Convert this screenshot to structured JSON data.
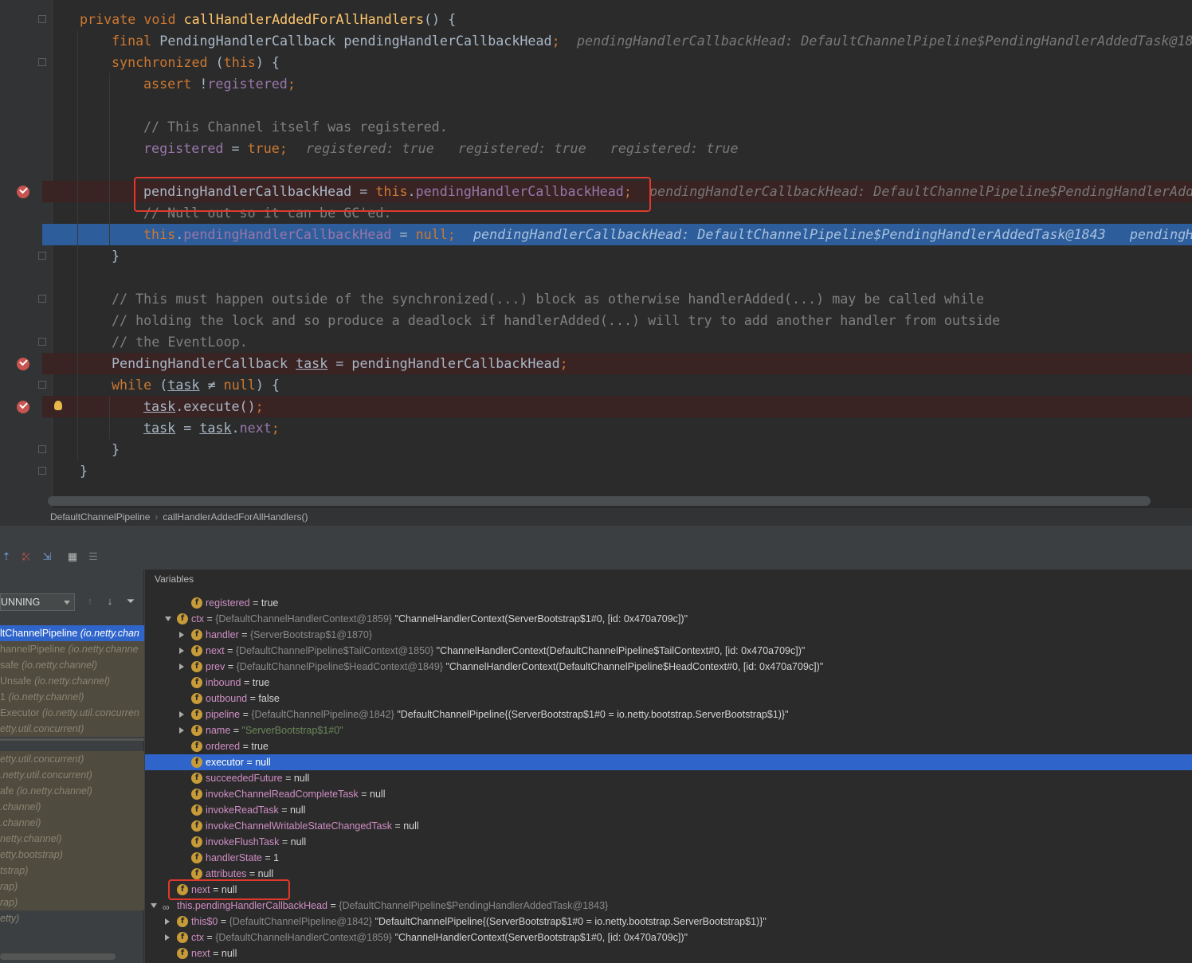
{
  "editor": {
    "lines": [
      {
        "code": [
          [
            "kw",
            "private void "
          ],
          [
            "fn",
            "callHandlerAddedForAllHandlers"
          ],
          [
            "",
            "() {"
          ]
        ],
        "indent": 0
      },
      {
        "code": [
          [
            "kw",
            "final "
          ],
          [
            "",
            "PendingHandlerCallback pendingHandlerCallbackHead"
          ],
          [
            "kw",
            ";"
          ]
        ],
        "indent": 1,
        "hint": "pendingHandlerCallbackHead: DefaultChannelPipeline$PendingHandlerAddedTask@18"
      },
      {
        "code": [
          [
            "kw",
            "synchronized "
          ],
          [
            "",
            "("
          ],
          [
            "kw",
            "this"
          ],
          [
            "",
            ") {"
          ]
        ],
        "indent": 1
      },
      {
        "code": [
          [
            "kw",
            "assert "
          ],
          [
            "",
            "!"
          ],
          [
            "fld",
            "registered"
          ],
          [
            "kw",
            ";"
          ]
        ],
        "indent": 2
      },
      {
        "code": [],
        "indent": 2
      },
      {
        "code": [
          [
            "cm",
            "// This Channel itself was registered."
          ]
        ],
        "indent": 2
      },
      {
        "code": [
          [
            "fld",
            "registered"
          ],
          [
            "",
            " = "
          ],
          [
            "kw",
            "true;"
          ]
        ],
        "indent": 2,
        "hint": "registered: true   registered: true   registered: true"
      },
      {
        "code": [],
        "indent": 2
      },
      {
        "code": [
          [
            "",
            "pendingHandlerCallbackHead = "
          ],
          [
            "kw",
            "this"
          ],
          [
            "",
            "."
          ],
          [
            "fld",
            "pendingHandlerCallbackHead"
          ],
          [
            "kw",
            ";"
          ]
        ],
        "indent": 2,
        "hint": "pendingHandlerCallbackHead: DefaultChannelPipeline$PendingHandlerAdde",
        "bp": true
      },
      {
        "code": [
          [
            "cm",
            "// Null out so it can be GC'ed."
          ]
        ],
        "indent": 2
      },
      {
        "code": [
          [
            "kw",
            "this"
          ],
          [
            "",
            "."
          ],
          [
            "fld",
            "pendingHandlerCallbackHead"
          ],
          [
            "",
            " = "
          ],
          [
            "kw",
            "null;"
          ]
        ],
        "indent": 2,
        "hint": "pendingHandlerCallbackHead: DefaultChannelPipeline$PendingHandlerAddedTask@1843   pendingH",
        "sel": true
      },
      {
        "code": [
          [
            "",
            "}"
          ]
        ],
        "indent": 1
      },
      {
        "code": [],
        "indent": 1
      },
      {
        "code": [
          [
            "cm",
            "// This must happen outside of the synchronized(...) block as otherwise handlerAdded(...) may be called while"
          ]
        ],
        "indent": 1
      },
      {
        "code": [
          [
            "cm",
            "// holding the lock and so produce a deadlock if handlerAdded(...) will try to add another handler from outside"
          ]
        ],
        "indent": 1
      },
      {
        "code": [
          [
            "cm",
            "// the EventLoop."
          ]
        ],
        "indent": 1
      },
      {
        "code": [
          [
            "",
            "PendingHandlerCallback "
          ],
          [
            "ul",
            "task"
          ],
          [
            "",
            " = pendingHandlerCallbackHead"
          ],
          [
            "kw",
            ";"
          ]
        ],
        "indent": 1,
        "bp": true
      },
      {
        "code": [
          [
            "kw",
            "while "
          ],
          [
            "",
            "("
          ],
          [
            "ul",
            "task"
          ],
          [
            "",
            " ≠ "
          ],
          [
            "kw",
            "null"
          ],
          [
            "",
            ") {"
          ]
        ],
        "indent": 1
      },
      {
        "code": [
          [
            "ul",
            "task"
          ],
          [
            "",
            ".execute()"
          ],
          [
            "kw",
            ";"
          ]
        ],
        "indent": 2,
        "bp": true,
        "bulb": true
      },
      {
        "code": [
          [
            "ul",
            "task"
          ],
          [
            "",
            " = "
          ],
          [
            "ul",
            "task"
          ],
          [
            "",
            "."
          ],
          [
            "fld",
            "next"
          ],
          [
            "kw",
            ";"
          ]
        ],
        "indent": 2
      },
      {
        "code": [
          [
            "",
            "}"
          ]
        ],
        "indent": 1
      },
      {
        "code": [
          [
            "",
            "}"
          ]
        ],
        "indent": 0
      }
    ]
  },
  "breadcrumb": [
    "DefaultChannelPipeline",
    "callHandlerAddedForAllHandlers()"
  ],
  "debugger": {
    "toolbar_icons": [
      "step-out-icon",
      "drop-frame-icon",
      "run-to-cursor-icon",
      "evaluate-icon",
      "trace-icon"
    ],
    "thread_select": "UNNING",
    "frames": [
      {
        "method": "ltChannelPipeline ",
        "pkg": "(io.netty.chan",
        "sel": true
      },
      {
        "method": "hannelPipeline ",
        "pkg": "(io.netty.channe",
        "lib": true
      },
      {
        "method": "safe ",
        "pkg": "(io.netty.channel)",
        "lib": true
      },
      {
        "method": "Unsafe ",
        "pkg": "(io.netty.channel)",
        "lib": true
      },
      {
        "method": "1 ",
        "pkg": "(io.netty.channel)",
        "lib": true
      },
      {
        "method": "Executor ",
        "pkg": "(io.netty.util.concurren",
        "lib": true
      },
      {
        "method": "",
        "pkg": "etty.util.concurrent)",
        "lib": true
      },
      {
        "method": "",
        "pkg": "",
        "lib": false
      },
      {
        "method": "",
        "pkg": "etty.util.concurrent)",
        "lib": true
      },
      {
        "method": "",
        "pkg": ".netty.util.concurrent)",
        "lib": true
      },
      {
        "method": "afe ",
        "pkg": "(io.netty.channel)",
        "lib": true
      },
      {
        "method": "",
        "pkg": ".channel)",
        "lib": true
      },
      {
        "method": "",
        "pkg": ".channel)",
        "lib": true
      },
      {
        "method": "",
        "pkg": "netty.channel)",
        "lib": true
      },
      {
        "method": "",
        "pkg": "etty.bootstrap)",
        "lib": true
      },
      {
        "method": "",
        "pkg": "tstrap)",
        "lib": true
      },
      {
        "method": "",
        "pkg": "rap)",
        "lib": true
      },
      {
        "method": "",
        "pkg": "rap)",
        "lib": true
      },
      {
        "method": "",
        "pkg": "etty)",
        "lib": false
      }
    ],
    "variables_title": "Variables",
    "variables": [
      {
        "lvl": 3,
        "tw": "",
        "icon": "f",
        "name": "registered",
        "type": "",
        "value": "true"
      },
      {
        "lvl": 2,
        "tw": "d",
        "icon": "f",
        "name": "ctx",
        "type": "{DefaultChannelHandlerContext@1859}",
        "value": "\"ChannelHandlerContext(ServerBootstrap$1#0, [id: 0x470a709c])\""
      },
      {
        "lvl": 3,
        "tw": "r",
        "icon": "f",
        "name": "handler",
        "type": "{ServerBootstrap$1@1870}",
        "value": ""
      },
      {
        "lvl": 3,
        "tw": "r",
        "icon": "f",
        "name": "next",
        "type": "{DefaultChannelPipeline$TailContext@1850}",
        "value": "\"ChannelHandlerContext(DefaultChannelPipeline$TailContext#0, [id: 0x470a709c])\""
      },
      {
        "lvl": 3,
        "tw": "r",
        "icon": "f",
        "name": "prev",
        "type": "{DefaultChannelPipeline$HeadContext@1849}",
        "value": "\"ChannelHandlerContext(DefaultChannelPipeline$HeadContext#0, [id: 0x470a709c])\""
      },
      {
        "lvl": 3,
        "tw": "",
        "icon": "f",
        "name": "inbound",
        "type": "",
        "value": "true"
      },
      {
        "lvl": 3,
        "tw": "",
        "icon": "f",
        "name": "outbound",
        "type": "",
        "value": "false"
      },
      {
        "lvl": 3,
        "tw": "r",
        "icon": "f",
        "name": "pipeline",
        "type": "{DefaultChannelPipeline@1842}",
        "value": "\"DefaultChannelPipeline{(ServerBootstrap$1#0 = io.netty.bootstrap.ServerBootstrap$1)}\""
      },
      {
        "lvl": 3,
        "tw": "r",
        "icon": "f",
        "name": "name",
        "type": "",
        "value": "\"ServerBootstrap$1#0\"",
        "str": true
      },
      {
        "lvl": 3,
        "tw": "",
        "icon": "f",
        "name": "ordered",
        "type": "",
        "value": "true"
      },
      {
        "lvl": 3,
        "tw": "",
        "icon": "f",
        "name": "executor",
        "type": "",
        "value": "null",
        "sel": true
      },
      {
        "lvl": 3,
        "tw": "",
        "icon": "f",
        "name": "succeededFuture",
        "type": "",
        "value": "null"
      },
      {
        "lvl": 3,
        "tw": "",
        "icon": "f",
        "name": "invokeChannelReadCompleteTask",
        "type": "",
        "value": "null"
      },
      {
        "lvl": 3,
        "tw": "",
        "icon": "f",
        "name": "invokeReadTask",
        "type": "",
        "value": "null"
      },
      {
        "lvl": 3,
        "tw": "",
        "icon": "f",
        "name": "invokeChannelWritableStateChangedTask",
        "type": "",
        "value": "null"
      },
      {
        "lvl": 3,
        "tw": "",
        "icon": "f",
        "name": "invokeFlushTask",
        "type": "",
        "value": "null"
      },
      {
        "lvl": 3,
        "tw": "",
        "icon": "f",
        "name": "handlerState",
        "type": "",
        "value": "1"
      },
      {
        "lvl": 3,
        "tw": "",
        "icon": "f",
        "name": "attributes",
        "type": "",
        "value": "null"
      },
      {
        "lvl": 2,
        "tw": "",
        "icon": "f",
        "name": "next",
        "type": "",
        "value": "null"
      },
      {
        "lvl": 1,
        "tw": "d",
        "icon": "oo",
        "name": "this.pendingHandlerCallbackHead",
        "type": "{DefaultChannelPipeline$PendingHandlerAddedTask@1843}",
        "value": ""
      },
      {
        "lvl": 2,
        "tw": "r",
        "icon": "f",
        "name": "this$0",
        "type": "{DefaultChannelPipeline@1842}",
        "value": "\"DefaultChannelPipeline{(ServerBootstrap$1#0 = io.netty.bootstrap.ServerBootstrap$1)}\""
      },
      {
        "lvl": 2,
        "tw": "r",
        "icon": "f",
        "name": "ctx",
        "type": "{DefaultChannelHandlerContext@1859}",
        "value": "\"ChannelHandlerContext(ServerBootstrap$1#0, [id: 0x470a709c])\""
      },
      {
        "lvl": 2,
        "tw": "",
        "icon": "f",
        "name": "next",
        "type": "",
        "value": "null"
      }
    ]
  }
}
